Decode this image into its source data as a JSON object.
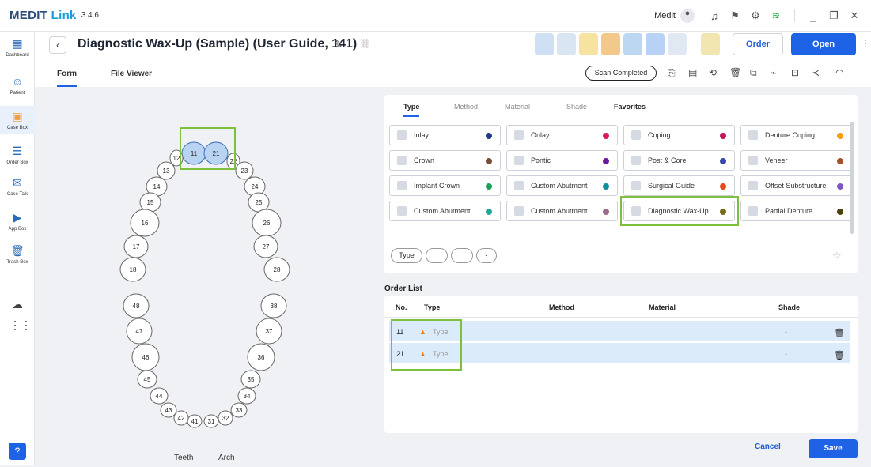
{
  "app": {
    "logo_main": "MEDIT",
    "logo_sub": "Link",
    "version": "3.4.6",
    "user": "Medit"
  },
  "sidebar": {
    "items": [
      {
        "label": "Dashboard",
        "icon": "dashboard-icon"
      },
      {
        "label": "Patient",
        "icon": "patient-icon"
      },
      {
        "label": "Case Box",
        "icon": "case-box-icon"
      },
      {
        "label": "Order Box",
        "icon": "order-box-icon"
      },
      {
        "label": "Case Talk",
        "icon": "case-talk-icon"
      },
      {
        "label": "App Box",
        "icon": "app-box-icon"
      },
      {
        "label": "Trash Box",
        "icon": "trash-box-icon"
      }
    ]
  },
  "header": {
    "title": "Diagnostic Wax-Up (Sample) (User Guide, 141)",
    "order_label": "Order",
    "open_label": "Open",
    "scan_status": "Scan Completed"
  },
  "tabs": {
    "form": "Form",
    "viewer": "File Viewer"
  },
  "chart": {
    "teeth_tab": "Teeth",
    "arch_tab": "Arch"
  },
  "type_tabs": [
    "Type",
    "Method",
    "Material",
    "Shade",
    "Favorites"
  ],
  "types": [
    {
      "label": "Inlay",
      "color": "#1e3a8a"
    },
    {
      "label": "Onlay",
      "color": "#d81b60"
    },
    {
      "label": "Coping",
      "color": "#c2185b"
    },
    {
      "label": "Denture Coping",
      "color": "#f59e0b"
    },
    {
      "label": "Crown",
      "color": "#7b4b3a"
    },
    {
      "label": "Pontic",
      "color": "#6a1b9a"
    },
    {
      "label": "Post & Core",
      "color": "#3949ab"
    },
    {
      "label": "Veneer",
      "color": "#a0522d"
    },
    {
      "label": "Implant Crown",
      "color": "#1b9e5a"
    },
    {
      "label": "Custom Abutment",
      "color": "#0e8f9a"
    },
    {
      "label": "Surgical Guide",
      "color": "#e64a19"
    },
    {
      "label": "Offset Substructure",
      "color": "#7e57c2"
    },
    {
      "label": "Custom Abutment ...",
      "color": "#26a69a"
    },
    {
      "label": "Custom Abutment ...",
      "color": "#9a6b8a"
    },
    {
      "label": "Diagnostic Wax-Up",
      "color": "#7a6a1a"
    },
    {
      "label": "Partial Denture",
      "color": "#4a4210"
    }
  ],
  "chip_label": "Type",
  "order_list": {
    "title": "Order List",
    "columns": [
      "No.",
      "Type",
      "Method",
      "Material",
      "Shade"
    ],
    "rows": [
      {
        "no": "11",
        "type": "Type",
        "shade": "-"
      },
      {
        "no": "21",
        "type": "Type",
        "shade": "-"
      }
    ]
  },
  "footer": {
    "cancel": "Cancel",
    "save": "Save"
  },
  "teeth": {
    "upper": [
      "11",
      "21",
      "12",
      "22",
      "13",
      "23",
      "14",
      "24",
      "15",
      "25",
      "16",
      "26",
      "17",
      "27",
      "18",
      "28"
    ],
    "lower": [
      "48",
      "38",
      "47",
      "37",
      "46",
      "36",
      "45",
      "35",
      "44",
      "34",
      "43",
      "33",
      "42",
      "32",
      "41",
      "31"
    ]
  }
}
